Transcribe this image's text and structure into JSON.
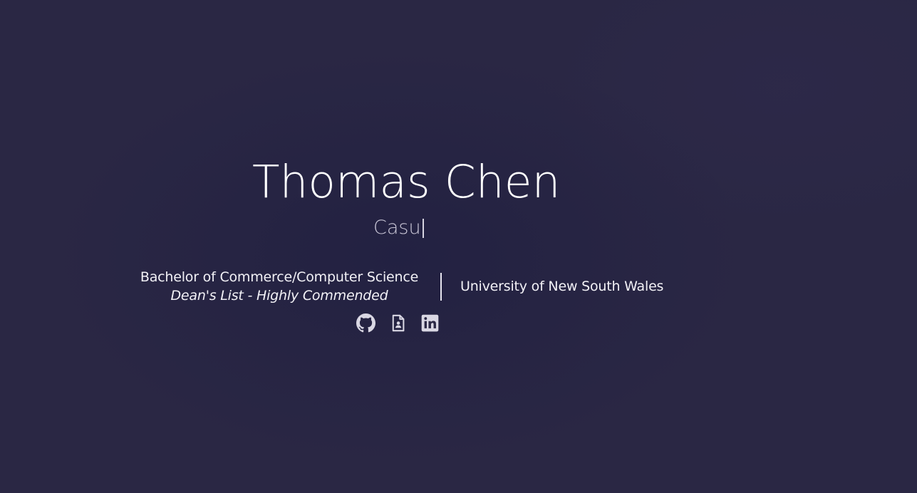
{
  "hero": {
    "name": "Thomas Chen",
    "typed_text": "Casu"
  },
  "education": {
    "degree": "Bachelor of Commerce/Computer Science",
    "honour": "Dean's List - Highly Commended",
    "university": "University of New South Wales"
  },
  "social_links": [
    {
      "icon": "github-icon",
      "label": "GitHub"
    },
    {
      "icon": "resume-icon",
      "label": "Resume"
    },
    {
      "icon": "linkedin-icon",
      "label": "LinkedIn"
    }
  ],
  "colors": {
    "background": "#2a2744",
    "text": "#ffffff",
    "subtext": "#c9c6d6",
    "icon": "#d9d7e3"
  }
}
